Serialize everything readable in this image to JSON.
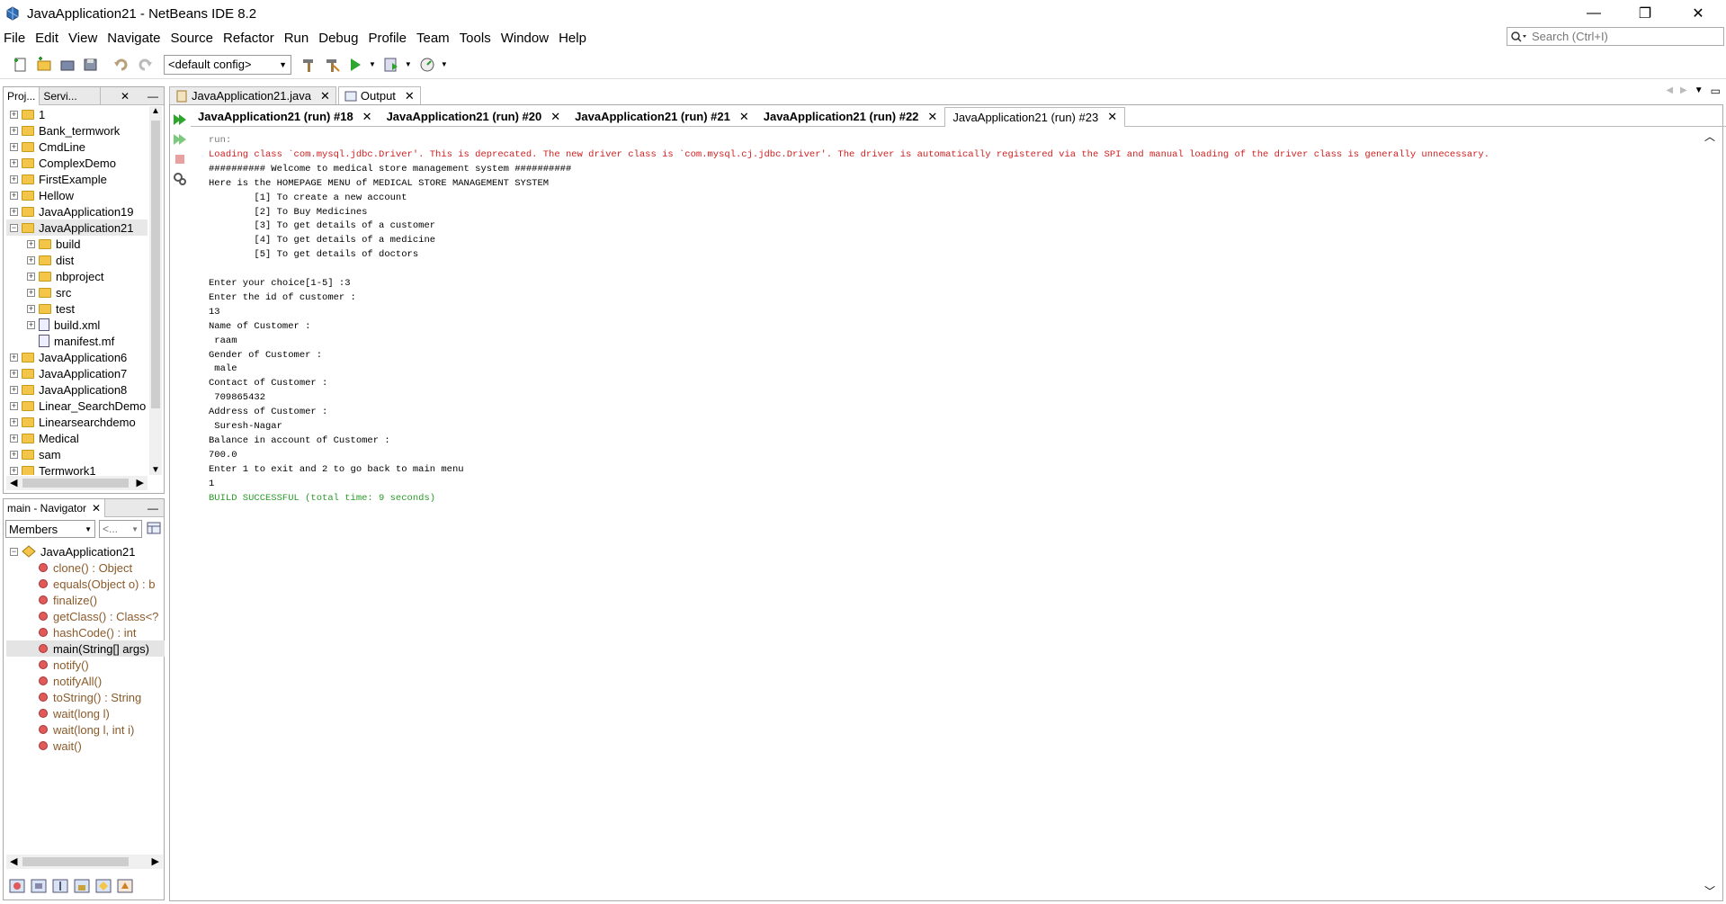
{
  "window": {
    "title": "JavaApplication21 - NetBeans IDE 8.2",
    "minimize": "—",
    "maximize": "❐",
    "close": "✕"
  },
  "menu": [
    "File",
    "Edit",
    "View",
    "Navigate",
    "Source",
    "Refactor",
    "Run",
    "Debug",
    "Profile",
    "Team",
    "Tools",
    "Window",
    "Help"
  ],
  "search": {
    "placeholder": "Search (Ctrl+I)"
  },
  "toolbar": {
    "config": "<default config>"
  },
  "projects_panel": {
    "tabs": [
      "Proj...",
      "Servi..."
    ],
    "items": [
      {
        "label": "1",
        "level": 0,
        "expanded": false,
        "kind": "folder"
      },
      {
        "label": "Bank_termwork",
        "level": 0,
        "expanded": false,
        "kind": "folder"
      },
      {
        "label": "CmdLine",
        "level": 0,
        "expanded": false,
        "kind": "folder"
      },
      {
        "label": "ComplexDemo",
        "level": 0,
        "expanded": false,
        "kind": "folder"
      },
      {
        "label": "FirstExample",
        "level": 0,
        "expanded": false,
        "kind": "folder"
      },
      {
        "label": "Hellow",
        "level": 0,
        "expanded": false,
        "kind": "folder"
      },
      {
        "label": "JavaApplication19",
        "level": 0,
        "expanded": false,
        "kind": "folder"
      },
      {
        "label": "JavaApplication21",
        "level": 0,
        "expanded": true,
        "kind": "folder"
      },
      {
        "label": "build",
        "level": 1,
        "expanded": false,
        "kind": "folder"
      },
      {
        "label": "dist",
        "level": 1,
        "expanded": false,
        "kind": "folder"
      },
      {
        "label": "nbproject",
        "level": 1,
        "expanded": false,
        "kind": "folder"
      },
      {
        "label": "src",
        "level": 1,
        "expanded": false,
        "kind": "folder"
      },
      {
        "label": "test",
        "level": 1,
        "expanded": false,
        "kind": "folder"
      },
      {
        "label": "build.xml",
        "level": 1,
        "expanded": false,
        "kind": "file"
      },
      {
        "label": "manifest.mf",
        "level": 1,
        "expanded": null,
        "kind": "file"
      },
      {
        "label": "JavaApplication6",
        "level": 0,
        "expanded": false,
        "kind": "folder"
      },
      {
        "label": "JavaApplication7",
        "level": 0,
        "expanded": false,
        "kind": "folder"
      },
      {
        "label": "JavaApplication8",
        "level": 0,
        "expanded": false,
        "kind": "folder"
      },
      {
        "label": "Linear_SearchDemo",
        "level": 0,
        "expanded": false,
        "kind": "folder"
      },
      {
        "label": "Linearsearchdemo",
        "level": 0,
        "expanded": false,
        "kind": "folder"
      },
      {
        "label": "Medical",
        "level": 0,
        "expanded": false,
        "kind": "folder"
      },
      {
        "label": "sam",
        "level": 0,
        "expanded": false,
        "kind": "folder"
      },
      {
        "label": "Termwork1",
        "level": 0,
        "expanded": false,
        "kind": "folder"
      }
    ]
  },
  "navigator": {
    "title": "main - Navigator",
    "filter": "Members",
    "filter2": "<...",
    "root": "JavaApplication21",
    "members": [
      "clone() : Object",
      "equals(Object o) : b",
      "finalize()",
      "getClass() : Class<?",
      "hashCode() : int",
      "main(String[] args)",
      "notify()",
      "notifyAll()",
      "toString() : String",
      "wait(long l)",
      "wait(long l, int i)",
      "wait()"
    ]
  },
  "editor_tabs": [
    "JavaApplication21.java",
    "Output"
  ],
  "run_tabs": [
    "JavaApplication21 (run) #18",
    "JavaApplication21 (run) #20",
    "JavaApplication21 (run) #21",
    "JavaApplication21 (run) #22",
    "JavaApplication21 (run) #23"
  ],
  "console": [
    {
      "text": "run:",
      "style": "gray"
    },
    {
      "text": "Loading class `com.mysql.jdbc.Driver'. This is deprecated. The new driver class is `com.mysql.cj.jdbc.Driver'. The driver is automatically registered via the SPI and manual loading of the driver class is generally unnecessary.",
      "style": "red"
    },
    {
      "text": "########## Welcome to medical store management system ##########",
      "style": ""
    },
    {
      "text": "Here is the HOMEPAGE MENU of MEDICAL STORE MANAGEMENT SYSTEM",
      "style": ""
    },
    {
      "text": "        [1] To create a new account",
      "style": ""
    },
    {
      "text": "        [2] To Buy Medicines",
      "style": ""
    },
    {
      "text": "        [3] To get details of a customer",
      "style": ""
    },
    {
      "text": "        [4] To get details of a medicine",
      "style": ""
    },
    {
      "text": "        [5] To get details of doctors",
      "style": ""
    },
    {
      "text": "",
      "style": ""
    },
    {
      "text": "Enter your choice[1-5] :3",
      "style": ""
    },
    {
      "text": "Enter the id of customer :",
      "style": ""
    },
    {
      "text": "13",
      "style": ""
    },
    {
      "text": "Name of Customer :",
      "style": ""
    },
    {
      "text": " raam",
      "style": ""
    },
    {
      "text": "Gender of Customer :",
      "style": ""
    },
    {
      "text": " male",
      "style": ""
    },
    {
      "text": "Contact of Customer :",
      "style": ""
    },
    {
      "text": " 709865432",
      "style": ""
    },
    {
      "text": "Address of Customer :",
      "style": ""
    },
    {
      "text": " Suresh-Nagar",
      "style": ""
    },
    {
      "text": "Balance in account of Customer :",
      "style": ""
    },
    {
      "text": "700.0",
      "style": ""
    },
    {
      "text": "Enter 1 to exit and 2 to go back to main menu",
      "style": ""
    },
    {
      "text": "1",
      "style": ""
    },
    {
      "text": "BUILD SUCCESSFUL (total time: 9 seconds)",
      "style": "green"
    }
  ],
  "colors": {
    "error": "#d02020",
    "success": "#2a9a2a",
    "folder": "#f3c64a"
  }
}
